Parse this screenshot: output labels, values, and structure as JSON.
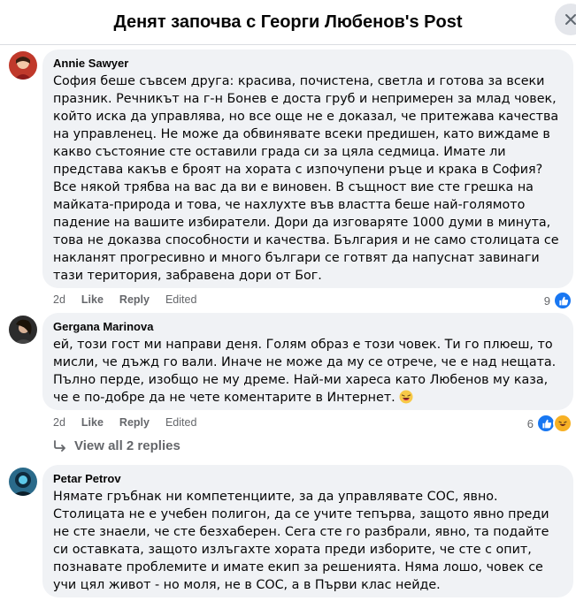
{
  "header": {
    "title": "Денят започва с Георги Любенов's Post"
  },
  "comments": [
    {
      "author": "Annie Sawyer",
      "text": "София беше съвсем друга: красива, почистена, светла и готова за всеки празник. Речникът на г-н Бонев е доста груб и непримерен за млад човек, който иска да управлява, но все още не е доказал, че притежава качества на управленец. Не може да обвинявате всеки предишен, като виждаме в какво състояние сте оставили града си за цяла седмица. Имате ли представа какъв е броят на хората с изпочупени ръце и крака в София? Все някой трябва на вас да ви е виновен. В същност вие сте грешка на майката-природа и това, че нахлухте във властта беше най-голямото падение на вашите избиратели. Дори да изговаряте 1000 думи в минута, това не доказва способности и качества. България и не само столицата се накланят прогресивно и много българи се готвят да напуснат завинаги тази територия, забравена дори от Бог.",
      "time": "2d",
      "like": "Like",
      "reply": "Reply",
      "edited": "Edited",
      "reaction_count": "9"
    },
    {
      "author": "Gergana Marinova",
      "text": "ей, този гост ми направи деня. Голям образ е този човек. Ти го плюеш, то мисли, че дъжд го вали. Иначе не може да му се отрече, че е над нещата. Пълно перде, изобщо не му дреме. Най-ми хареса като Любенов му каза, че е по-добре да не чете коментарите в Интернет.",
      "time": "2d",
      "like": "Like",
      "reply": "Reply",
      "edited": "Edited",
      "reaction_count": "6",
      "view_replies": "View all 2 replies"
    },
    {
      "author": "Petar Petrov",
      "text": "Нямате гръбнак ни компетенциите, за да управлявате СОС, явно. Столицата не е учебен полигон, да се учите тепърва, защото явно преди не сте знаели, че сте безхаберен. Сега сте го разбрали, явно, та подайте си оставката, защото излъгахте хората преди изборите, че сте с опит, познавате проблемите и имате екип за решенията. Няма лошо, човек се учи цял живот - но моля, не в СОС, а в Първи клас нейде."
    }
  ],
  "colors": {
    "like_blue": "#1877f2",
    "bubble_bg": "#f0f2f5",
    "muted": "#65676b"
  },
  "icons": [
    "close-icon",
    "like-reaction-icon",
    "haha-reaction-icon",
    "reply-arrow-icon",
    "laughing-emoji"
  ]
}
